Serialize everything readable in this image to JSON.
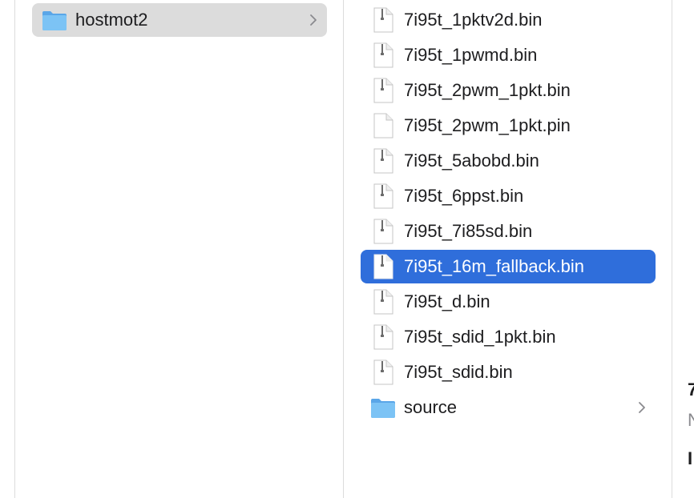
{
  "column1": {
    "items": [
      {
        "label": "hostmot2",
        "type": "folder",
        "selected": true,
        "has_children": true
      }
    ]
  },
  "column2": {
    "items": [
      {
        "label": "7i95t_1pktv2d.bin",
        "type": "binary-file"
      },
      {
        "label": "7i95t_1pwmd.bin",
        "type": "binary-file"
      },
      {
        "label": "7i95t_2pwm_1pkt.bin",
        "type": "binary-file"
      },
      {
        "label": "7i95t_2pwm_1pkt.pin",
        "type": "text-file"
      },
      {
        "label": "7i95t_5abobd.bin",
        "type": "binary-file"
      },
      {
        "label": "7i95t_6ppst.bin",
        "type": "binary-file"
      },
      {
        "label": "7i95t_7i85sd.bin",
        "type": "binary-file"
      },
      {
        "label": "7i95t_16m_fallback.bin",
        "type": "binary-file",
        "selected": true
      },
      {
        "label": "7i95t_d.bin",
        "type": "binary-file"
      },
      {
        "label": "7i95t_sdid_1pkt.bin",
        "type": "binary-file"
      },
      {
        "label": "7i95t_sdid.bin",
        "type": "binary-file"
      },
      {
        "label": "source",
        "type": "folder",
        "has_children": true
      }
    ]
  },
  "preview": {
    "line1": "7",
    "line2": "N",
    "line3": "I"
  },
  "colors": {
    "selection_blue": "#2f6edb",
    "selection_gray": "#dcdcdc",
    "folder_blue": "#6cb4f0",
    "divider": "#dcdcdc"
  }
}
